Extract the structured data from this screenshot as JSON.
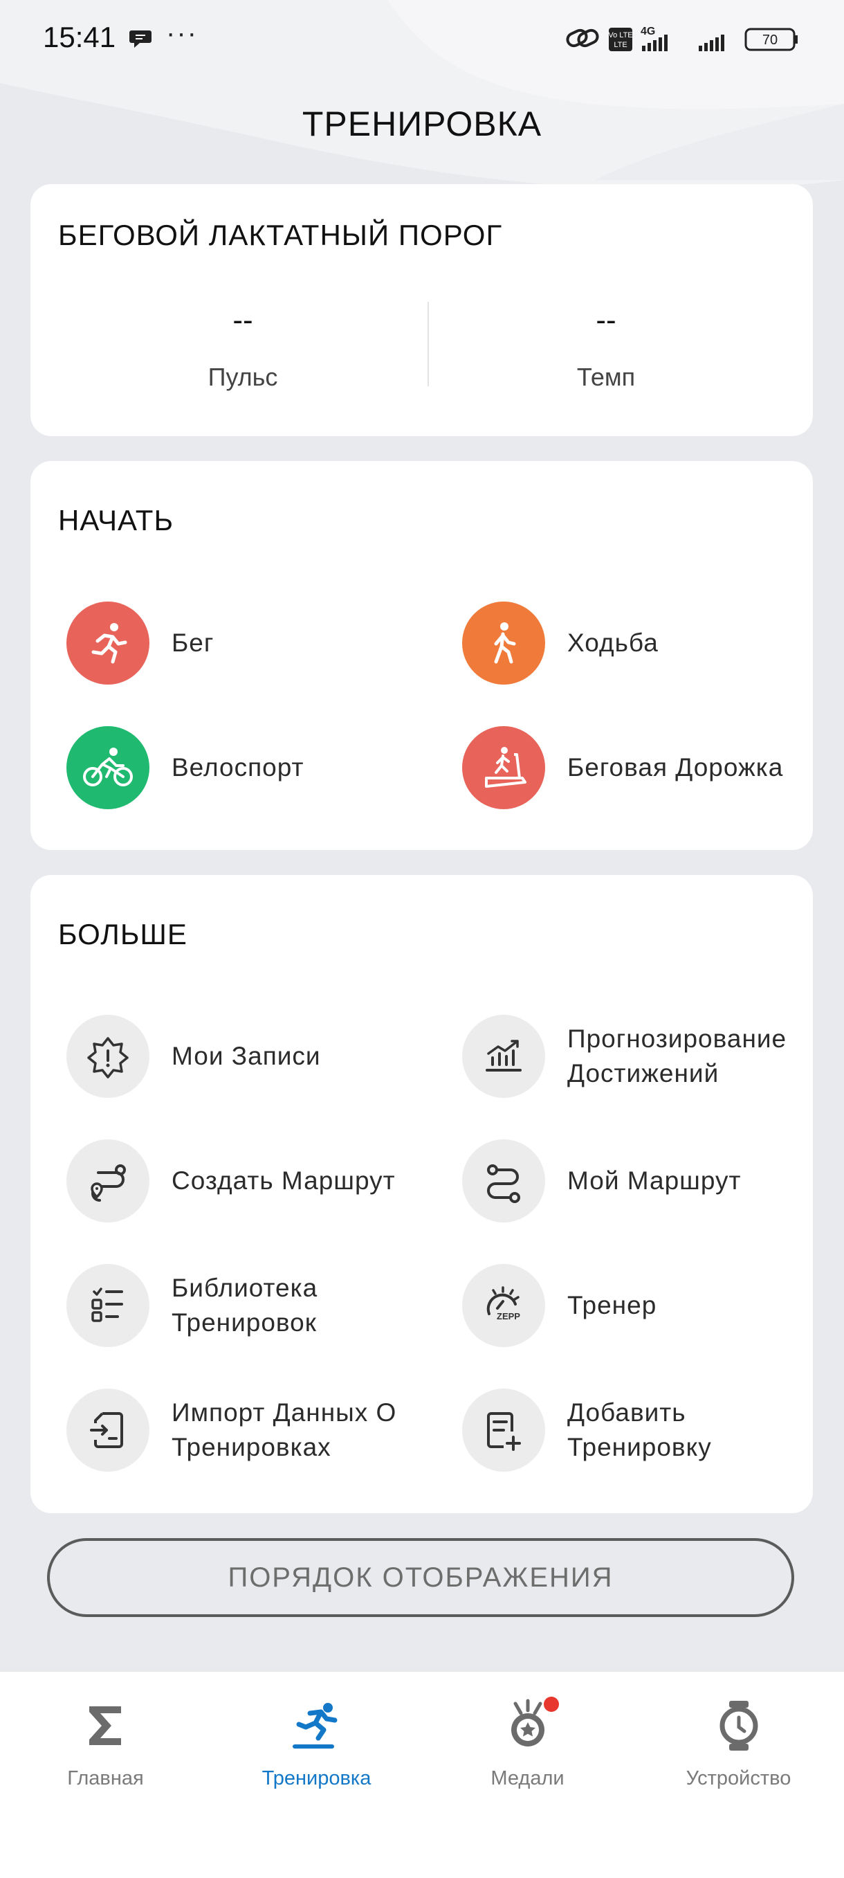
{
  "status_bar": {
    "time": "15:41",
    "dots": "···",
    "battery": "70",
    "network": "4G",
    "volte": "Vo LTE"
  },
  "page_title": "ТРЕНИРОВКА",
  "lactate_card": {
    "title": "БЕГОВОЙ ЛАКТАТНЫЙ ПОРОГ",
    "pulse_value": "--",
    "pulse_label": "Пульс",
    "pace_value": "--",
    "pace_label": "Темп"
  },
  "start_card": {
    "title": "НАЧАТЬ",
    "items": [
      {
        "label": "Бег",
        "icon": "running-icon",
        "color": "#e8645a"
      },
      {
        "label": "Ходьба",
        "icon": "walking-icon",
        "color": "#f07a3a"
      },
      {
        "label": "Велоспорт",
        "icon": "cycling-icon",
        "color": "#20b970"
      },
      {
        "label": "Беговая Дорожка",
        "icon": "treadmill-icon",
        "color": "#e8645a"
      }
    ]
  },
  "more_card": {
    "title": "БОЛЬШЕ",
    "items": [
      {
        "line1": "Мои Записи",
        "line2": "",
        "icon": "records-badge-icon"
      },
      {
        "line1": "Прогнозирование",
        "line2": "Достижений",
        "icon": "chart-prediction-icon"
      },
      {
        "line1": "Создать Маршрут",
        "line2": "",
        "icon": "create-route-icon"
      },
      {
        "line1": "Мой Маршрут",
        "line2": "",
        "icon": "my-route-icon"
      },
      {
        "line1": "Библиотека",
        "line2": "Тренировок",
        "icon": "workout-library-icon"
      },
      {
        "line1": "Тренер",
        "line2": "",
        "icon": "zepp-coach-icon"
      },
      {
        "line1": "Импорт Данных О",
        "line2": "Тренировках",
        "icon": "import-data-icon"
      },
      {
        "line1": "Добавить",
        "line2": "Тренировку",
        "icon": "add-workout-icon"
      }
    ]
  },
  "order_button": "ПОРЯДОК ОТОБРАЖЕНИЯ",
  "tabs": [
    {
      "label": "Главная",
      "icon": "sigma-icon",
      "active": false
    },
    {
      "label": "Тренировка",
      "icon": "workout-runner-icon",
      "active": true
    },
    {
      "label": "Медали",
      "icon": "medal-icon",
      "active": false
    },
    {
      "label": "Устройство",
      "icon": "watch-icon",
      "active": false
    }
  ],
  "zepp_text": "ZEPP",
  "colors": {
    "accent": "#1478c8",
    "run": "#e8645a",
    "walk": "#f07a3a",
    "cycle": "#20b970",
    "badge": "#e8372e"
  }
}
